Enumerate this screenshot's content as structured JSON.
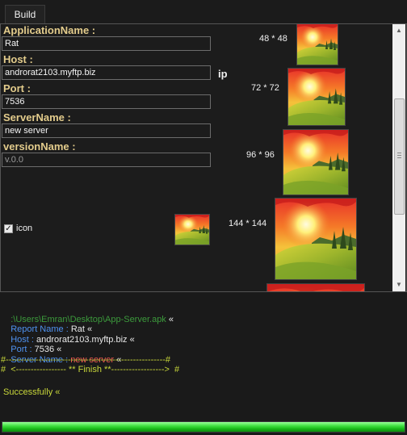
{
  "tabs": [
    {
      "label": "Build"
    }
  ],
  "form": {
    "application_name": {
      "label": "ApplicationName :",
      "value": "Rat"
    },
    "host": {
      "label": "Host :",
      "value": "androrat2103.myftp.biz",
      "suffix": "ip"
    },
    "port": {
      "label": "Port :",
      "value": "7536"
    },
    "server_name": {
      "label": "ServerName :",
      "value": "new server"
    },
    "version_name": {
      "label": "versionName :",
      "value": "v.0.0"
    },
    "icon_checkbox": {
      "label": "icon",
      "checked": true
    }
  },
  "icon_sizes": [
    {
      "label": "48 * 48",
      "icon": "sunset-landscape-icon"
    },
    {
      "label": "72 * 72",
      "icon": "sunset-landscape-icon"
    },
    {
      "label": "96 * 96",
      "icon": "sunset-landscape-icon"
    },
    {
      "label": "144 * 144",
      "icon": "sunset-landscape-icon"
    }
  ],
  "console": {
    "path": ":\\Users\\Emran\\Desktop\\App-Server.apk",
    "path_mark": "«",
    "report_label": "Report Name :",
    "report_value": "Rat «",
    "host_label": "Host :",
    "host_value": "androrat2103.myftp.biz «",
    "port_label": "Port :",
    "port_value": "7536 «",
    "server_label": "Server Name :",
    "server_value": "new server",
    "server_mark": "«",
    "separator": "#------------------------------------------------------#",
    "finish_line": "#  <----------------- ** Finish **------------------>  #",
    "success": " Successfully «"
  },
  "progress": {
    "percent": 100
  },
  "colors": {
    "label_gold": "#e3cc8c",
    "console_green": "#3c9a3c",
    "console_blue": "#4f92f0",
    "console_red": "#f05a50",
    "console_yellow": "#c9d83a",
    "progress_green": "#22cc22"
  }
}
